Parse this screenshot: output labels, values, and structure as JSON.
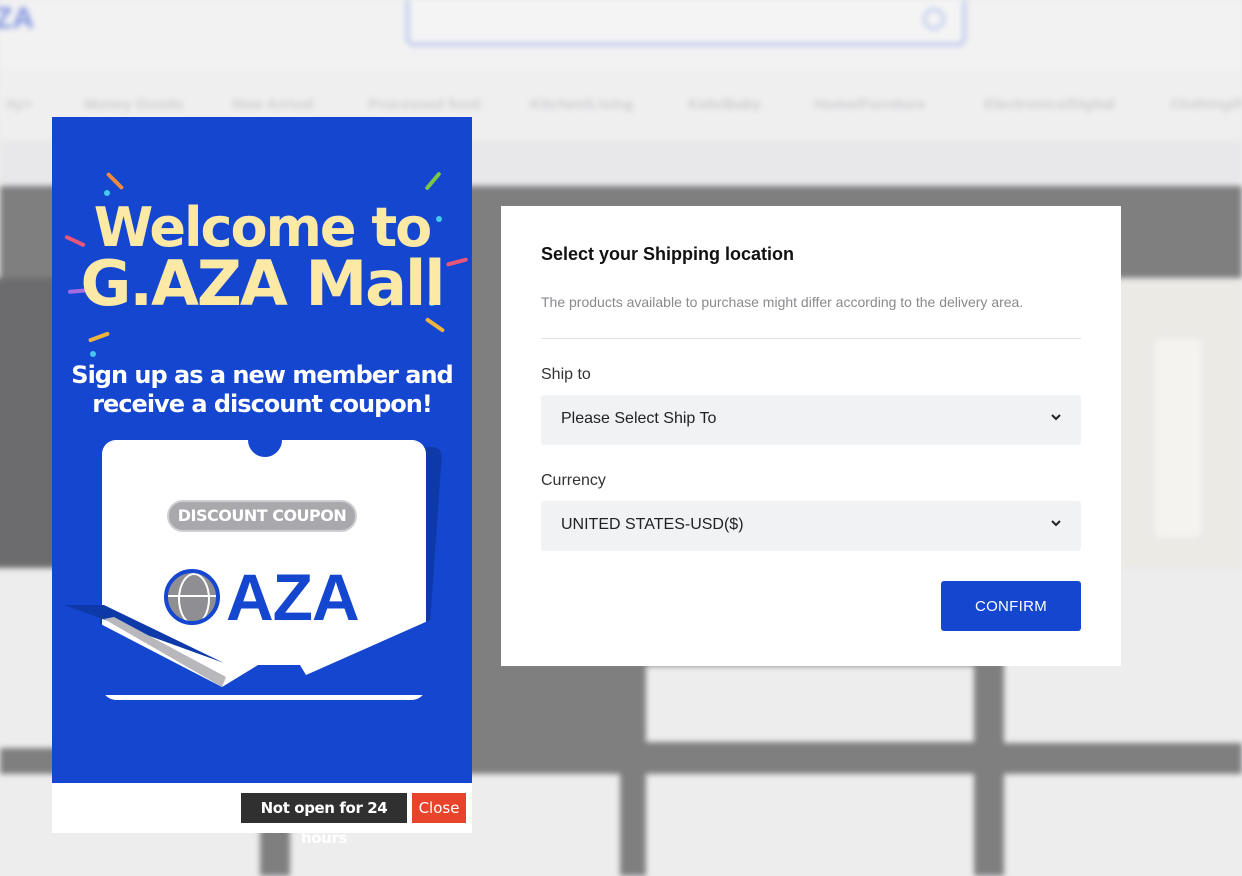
{
  "background": {
    "logo": "ZA",
    "nav_items": [
      "ity>",
      "Money Goods",
      "New Arrival",
      "Processed food",
      "Kitchen/Living",
      "Kids/Baby",
      "Home/Furniture",
      "Electronics/Digital",
      "Clothing/Fas"
    ]
  },
  "promo": {
    "title_line1": "Welcome to",
    "title_line2": "G.AZA Mall",
    "subtitle_line1": "Sign up as a new member and",
    "subtitle_line2": "receive a discount coupon!",
    "coupon_badge": "DISCOUNT COUPON",
    "brand": "AZA",
    "not_open_label": "Not open for 24 hours",
    "close_label": "Close",
    "colors": {
      "background": "#1446d0",
      "title": "#fde9a6",
      "close": "#e8442c"
    }
  },
  "shipping_modal": {
    "title": "Select your Shipping location",
    "description": "The products available to purchase might differ according to the delivery area.",
    "ship_to": {
      "label": "Ship to",
      "value": "Please Select Ship To"
    },
    "currency": {
      "label": "Currency",
      "value": "UNITED STATES-USD($)"
    },
    "confirm_label": "CONFIRM",
    "colors": {
      "accent": "#1446d0"
    }
  }
}
